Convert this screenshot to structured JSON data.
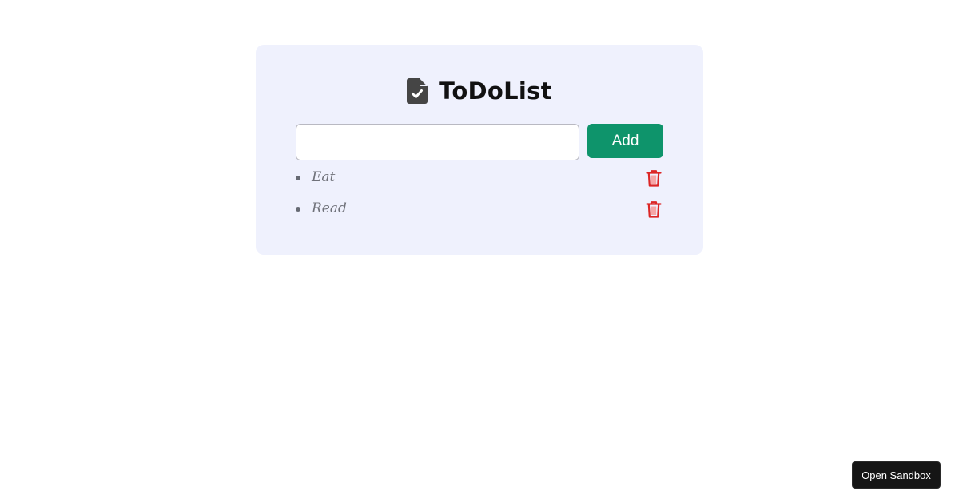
{
  "app": {
    "title": "ToDoList",
    "title_icon": "file-check-icon"
  },
  "input": {
    "value": "",
    "placeholder": ""
  },
  "add_button": {
    "label": "Add",
    "color": "#0e946b"
  },
  "todos": [
    {
      "text": "Eat",
      "delete_icon": "trash-icon"
    },
    {
      "text": "Read",
      "delete_icon": "trash-icon"
    }
  ],
  "sandbox_button": {
    "label": "Open Sandbox"
  },
  "colors": {
    "card_background": "#eff1fd",
    "delete_icon": "#dc2626",
    "item_text": "#70727a"
  }
}
